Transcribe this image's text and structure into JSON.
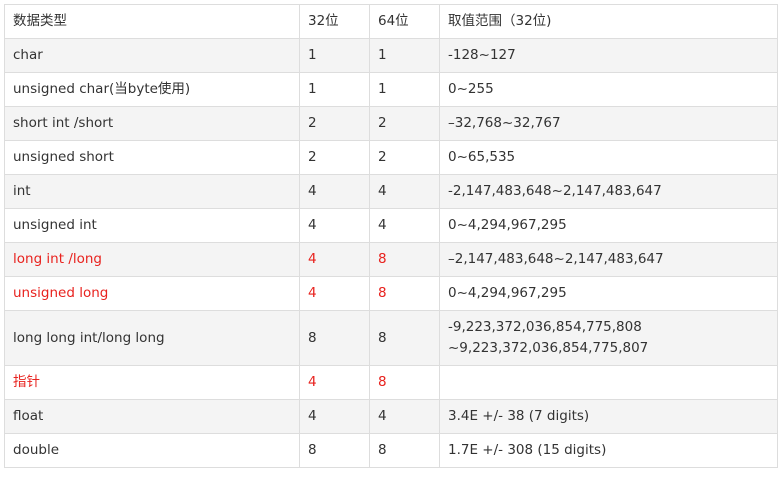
{
  "header": {
    "type": "数据类型",
    "bits32": "32位",
    "bits64": "64位",
    "range": "取值范围（32位)"
  },
  "rows": [
    {
      "type": "char",
      "bits32": "1",
      "bits64": "1",
      "range": [
        "-128~127"
      ],
      "highlight": "none"
    },
    {
      "type": "unsigned char(当byte使用)",
      "bits32": "1",
      "bits64": "1",
      "range": [
        "0~255"
      ],
      "highlight": "none"
    },
    {
      "type": "short int /short",
      "bits32": "2",
      "bits64": "2",
      "range": [
        "–32,768~32,767"
      ],
      "highlight": "none"
    },
    {
      "type": "unsigned  short",
      "bits32": "2",
      "bits64": "2",
      "range": [
        "0~65,535"
      ],
      "highlight": "none"
    },
    {
      "type": "int",
      "bits32": "4",
      "bits64": "4",
      "range": [
        "-2,147,483,648~2,147,483,647"
      ],
      "highlight": "none"
    },
    {
      "type": "unsigned int",
      "bits32": "4",
      "bits64": "4",
      "range": [
        "0~4,294,967,295"
      ],
      "highlight": "none"
    },
    {
      "type": "long int /long",
      "bits32": "4",
      "bits64": "8",
      "range": [
        "–2,147,483,648~2,147,483,647"
      ],
      "highlight": "type-size"
    },
    {
      "type": "unsigned long",
      "bits32": "4",
      "bits64": "8",
      "range": [
        "0~4,294,967,295"
      ],
      "highlight": "type-size"
    },
    {
      "type": "long long int/long long",
      "bits32": "8",
      "bits64": "8",
      "range": [
        "-9,223,372,036,854,775,808",
        "~9,223,372,036,854,775,807"
      ],
      "highlight": "none"
    },
    {
      "type": "指针",
      "bits32": "4",
      "bits64": "8",
      "range": [
        ""
      ],
      "highlight": "type-size"
    },
    {
      "type": "float",
      "bits32": "4",
      "bits64": "4",
      "range": [
        "3.4E +/- 38 (7 digits)"
      ],
      "highlight": "none"
    },
    {
      "type": "double",
      "bits32": "8",
      "bits64": "8",
      "range": [
        "1.7E +/- 308 (15 digits)"
      ],
      "highlight": "none"
    }
  ],
  "colors": {
    "highlight_text": "#e8221e",
    "text": "#333333",
    "border": "#dddddd",
    "stripe": "#f4f4f4"
  }
}
